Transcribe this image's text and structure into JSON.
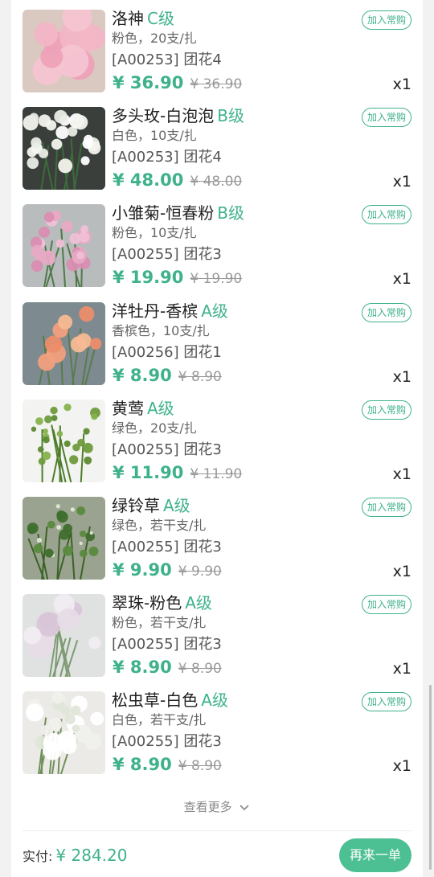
{
  "products": [
    {
      "name": "洛神",
      "grade": "C级",
      "spec": "粉色，20支/扎",
      "code": "[A00253] 团花4",
      "price": "¥ 36.90",
      "original_price": "¥ 36.90",
      "quantity": "x1",
      "add_label": "加入常购",
      "image": "pink-roses"
    },
    {
      "name": "多头玫-白泡泡",
      "grade": "B级",
      "spec": "白色，10支/扎",
      "code": "[A00253] 团花4",
      "price": "¥ 48.00",
      "original_price": "¥ 48.00",
      "quantity": "x1",
      "add_label": "加入常购",
      "image": "white-spray-roses"
    },
    {
      "name": "小雏菊-恒春粉",
      "grade": "B级",
      "spec": "粉色，10支/扎",
      "code": "[A00255] 团花3",
      "price": "¥ 19.90",
      "original_price": "¥ 19.90",
      "quantity": "x1",
      "add_label": "加入常购",
      "image": "pink-daisies"
    },
    {
      "name": "洋牡丹-香槟",
      "grade": "A级",
      "spec": "香槟色，10支/扎",
      "code": "[A00256] 团花1",
      "price": "¥ 8.90",
      "original_price": "¥ 8.90",
      "quantity": "x1",
      "add_label": "加入常购",
      "image": "champagne-ranunculus"
    },
    {
      "name": "黄莺",
      "grade": "A级",
      "spec": "绿色，20支/扎",
      "code": "[A00255] 团花3",
      "price": "¥ 11.90",
      "original_price": "¥ 11.90",
      "quantity": "x1",
      "add_label": "加入常购",
      "image": "green-solidago"
    },
    {
      "name": "绿铃草",
      "grade": "A级",
      "spec": "绿色，若干支/扎",
      "code": "[A00255] 团花3",
      "price": "¥ 9.90",
      "original_price": "¥ 9.90",
      "quantity": "x1",
      "add_label": "加入常购",
      "image": "green-bells"
    },
    {
      "name": "翠珠-粉色",
      "grade": "A级",
      "spec": "粉色，若干支/扎",
      "code": "[A00255] 团花3",
      "price": "¥ 8.90",
      "original_price": "¥ 8.90",
      "quantity": "x1",
      "add_label": "加入常购",
      "image": "pink-trachelium"
    },
    {
      "name": "松虫草-白色",
      "grade": "A级",
      "spec": "白色，若干支/扎",
      "code": "[A00255] 团花3",
      "price": "¥ 8.90",
      "original_price": "¥ 8.90",
      "quantity": "x1",
      "add_label": "加入常购",
      "image": "white-scabiosa"
    }
  ],
  "view_more": {
    "label": "查看更多",
    "icon": "chevron-down-icon"
  },
  "footer": {
    "paid_label": "实付:",
    "paid_amount": "¥ 284.20",
    "reorder_label": "再来一单"
  },
  "colors": {
    "accent": "#3fb28a",
    "button": "#4cbf93",
    "background": "#f2f2f2"
  }
}
